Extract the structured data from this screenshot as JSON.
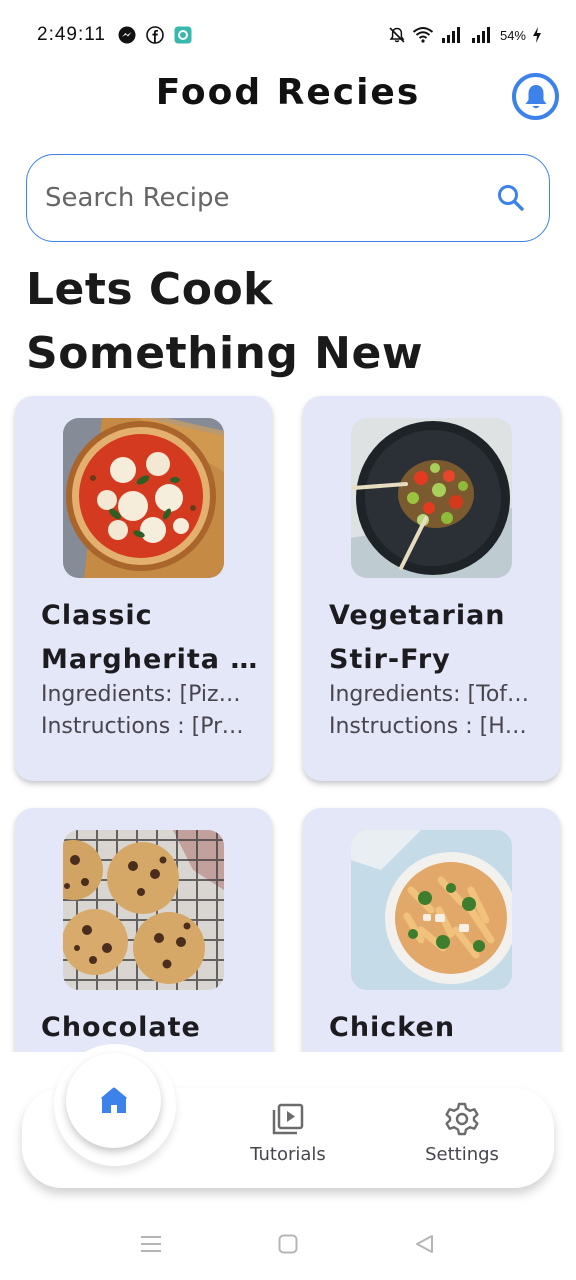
{
  "status_bar": {
    "time": "2:49:11",
    "battery": "54%",
    "left_icons": [
      "messenger-icon",
      "facebook-icon",
      "app-icon"
    ],
    "right_icons": [
      "mute-bell-icon",
      "wifi-icon",
      "signal-icon",
      "signal-icon",
      "charging-icon"
    ]
  },
  "header": {
    "title": "Food Recies",
    "bell_icon": "notification-bell-icon"
  },
  "search": {
    "placeholder": "Search Recipe",
    "icon": "search-icon"
  },
  "headline": "Lets Cook Something New Today!",
  "recipes": [
    {
      "title_lines": [
        "Classic",
        "Margherita Pizza"
      ],
      "ingredients": "Ingredients: [Pizza dough]",
      "instructions": "Instructions : [Preheat oven]",
      "image": "pizza"
    },
    {
      "title_lines": [
        "Vegetarian",
        "Stir-Fry"
      ],
      "ingredients": "Ingredients: [Tofu, vegetables]",
      "instructions": "Instructions : [Heat oil]",
      "image": "stir-fry"
    },
    {
      "title_lines": [
        "Chocolate"
      ],
      "image": "cookies"
    },
    {
      "title_lines": [
        "Chicken"
      ],
      "image": "pasta"
    }
  ],
  "bottom_nav": {
    "items": [
      {
        "label": "",
        "icon": "home-icon",
        "active": true
      },
      {
        "label": "Tutorials",
        "icon": "video-library-icon"
      },
      {
        "label": "Settings",
        "icon": "gear-icon"
      }
    ]
  },
  "system_nav": {
    "icons": [
      "menu-icon",
      "home-square-icon",
      "back-icon"
    ]
  },
  "colors": {
    "accent": "#3d82ea",
    "card_bg": "#e3e7f7",
    "text_dark": "#1c1b1f",
    "text_muted": "#49454f"
  }
}
